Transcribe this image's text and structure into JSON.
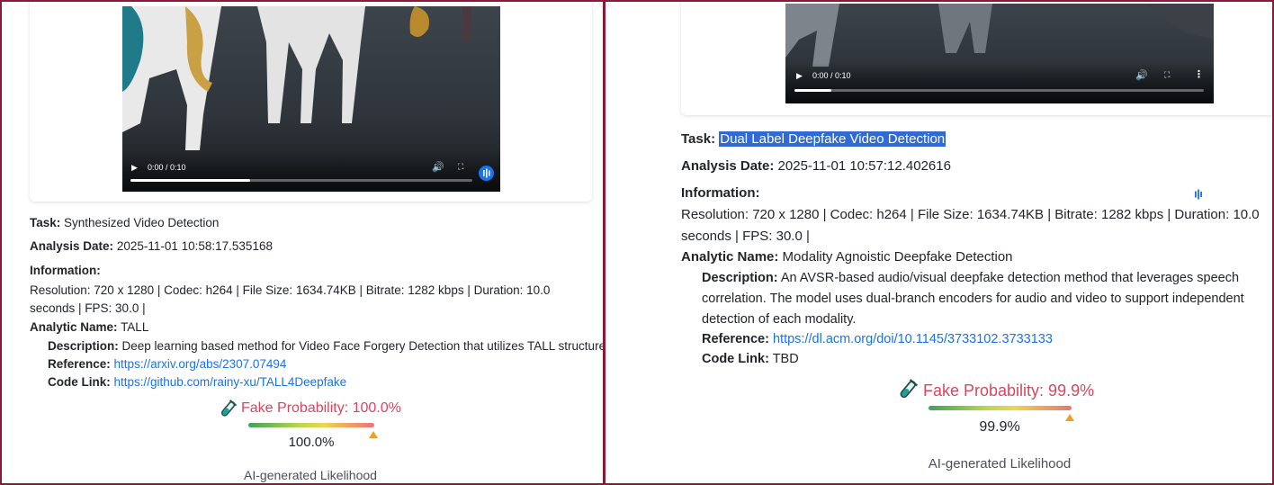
{
  "left": {
    "video": {
      "time": "0:00 / 0:10",
      "progress": 0.35
    },
    "task": {
      "label": "Task:",
      "value": "Synthesized Video Detection"
    },
    "analysis_date": {
      "label": "Analysis Date:",
      "value": "2025-11-01 10:58:17.535168"
    },
    "information": {
      "label": "Information:",
      "line1": "Resolution: 720 x 1280 | Codec: h264 | File Size: 1634.74KB | Bitrate: 1282 kbps | Duration: 10.0",
      "line2": "seconds | FPS: 30.0 |"
    },
    "analytic_name": {
      "label": "Analytic Name:",
      "value": "TALL"
    },
    "description": {
      "label": "Description:",
      "value": "Deep learning based method for Video Face Forgery Detection that utilizes TALL structure"
    },
    "reference": {
      "label": "Reference:",
      "value": "https://arxiv.org/abs/2307.07494"
    },
    "code_link": {
      "label": "Code Link:",
      "value": "https://github.com/rainy-xu/TALL4Deepfake"
    },
    "fake_probability": {
      "label": "Fake Probability: 100.0%",
      "value": 100.0,
      "percent_text": "100.0%"
    },
    "likelihood_label": "AI-generated Likelihood"
  },
  "right": {
    "video": {
      "time": "0:00 / 0:10",
      "progress": 0.09
    },
    "task": {
      "label": "Task:",
      "value": "Dual Label Deepfake Video Detection"
    },
    "analysis_date": {
      "label": "Analysis Date:",
      "value": "2025-11-01 10:57:12.402616"
    },
    "information": {
      "label": "Information:",
      "line1": "Resolution: 720 x 1280 | Codec: h264 | File Size: 1634.74KB | Bitrate: 1282 kbps | Duration: 10.0",
      "line2": "seconds | FPS: 30.0 |"
    },
    "analytic_name": {
      "label": "Analytic Name:",
      "value": "Modality Agnoistic Deepfake Detection"
    },
    "description": {
      "label": "Description:",
      "line1": "An AVSR-based audio/visual deepfake detection method that leverages speech",
      "line2": "correlation. The model uses dual-branch encoders for audio and video to support independent",
      "line3": "detection of each modality."
    },
    "reference": {
      "label": "Reference:",
      "value": "https://dl.acm.org/doi/10.1145/3733102.3733133"
    },
    "code_link": {
      "label": "Code Link:",
      "value": "TBD"
    },
    "fake_probability": {
      "label": "Fake Probability: 99.9%",
      "value": 99.9,
      "percent_text": "99.9%"
    },
    "likelihood_label": "AI-generated Likelihood"
  },
  "colors": {
    "fake_red": "#d9475f",
    "link_blue": "#1a73e8",
    "highlight": "#2f6bd3",
    "frame": "#8b1a3a"
  },
  "icons": [
    "test-tube-icon",
    "play-icon",
    "volume-icon",
    "fullscreen-icon",
    "more-icon",
    "audio-wave-icon"
  ]
}
